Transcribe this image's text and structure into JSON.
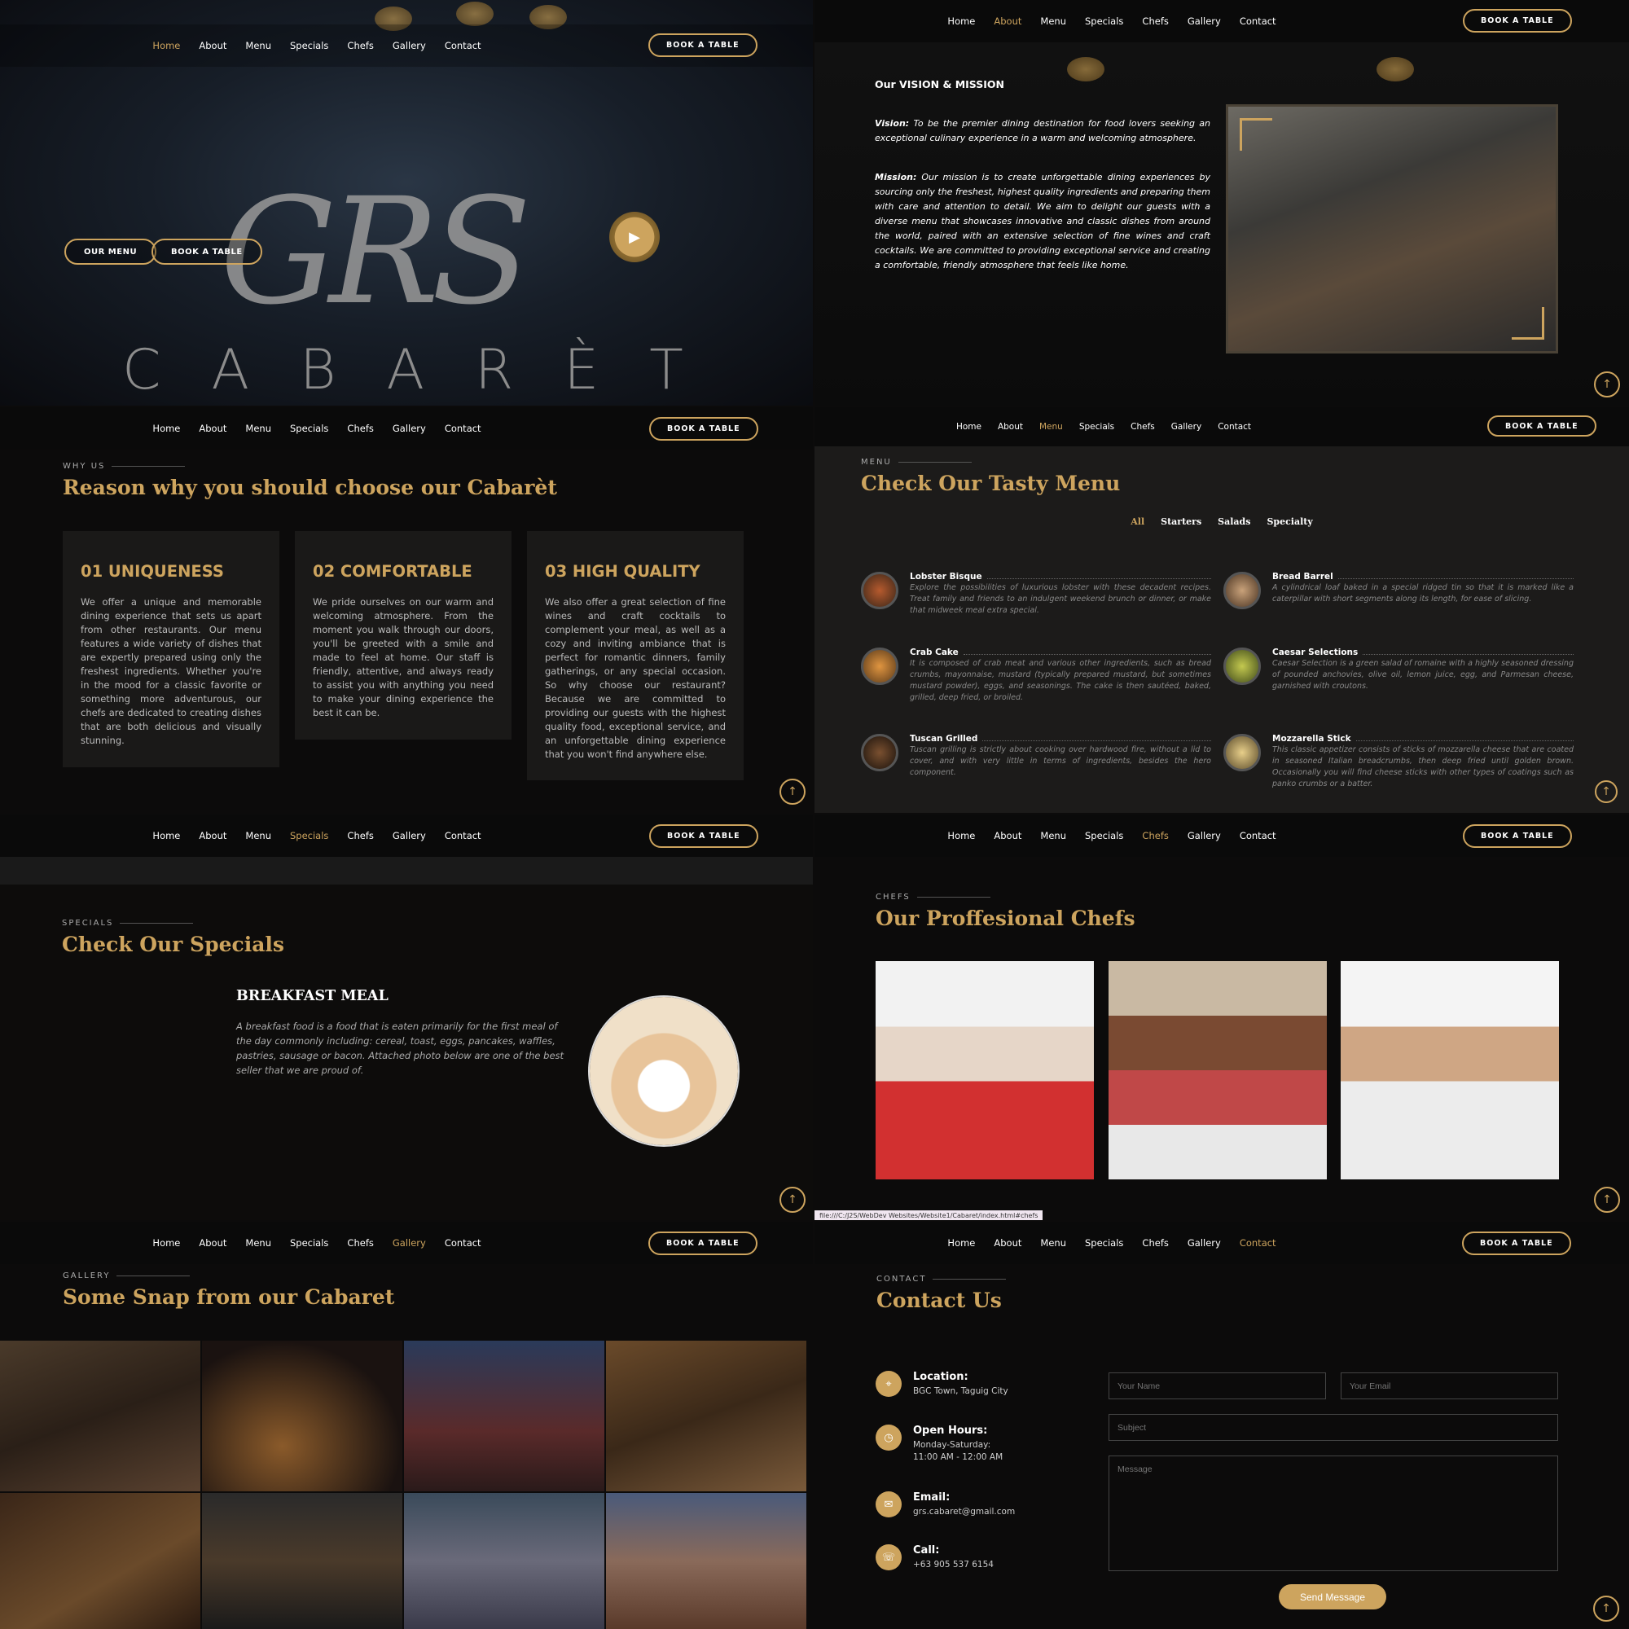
{
  "nav": {
    "links": [
      "Home",
      "About",
      "Menu",
      "Specials",
      "Chefs",
      "Gallery",
      "Contact"
    ],
    "book_label": "BOOK A TABLE"
  },
  "hero": {
    "script_text": "GRS",
    "wordmark": "CABARÈT",
    "our_menu_label": "OUR MENU",
    "book_label": "BOOK A TABLE",
    "active_nav": "Home"
  },
  "about": {
    "heading": "Our VISION & MISSION",
    "vision_label": "Vision:",
    "vision_text": "To be the premier dining destination for food lovers seeking an exceptional culinary experience in a warm and welcoming atmosphere.",
    "mission_label": "Mission:",
    "mission_text": "Our mission is to create unforgettable dining experiences by sourcing only the freshest, highest quality ingredients and preparing them with care and attention to detail. We aim to delight our guests with a diverse menu that showcases innovative and classic dishes from around the world, paired with an extensive selection of fine wines and craft cocktails. We are committed to providing exceptional service and creating a comfortable, friendly atmosphere that feels like home.",
    "active_nav": "About"
  },
  "why": {
    "label": "WHY US",
    "title": "Reason why you should choose our Cabarèt",
    "cards": [
      {
        "title": "01 UNIQUENESS",
        "text": "We offer a unique and memorable dining experience that sets us apart from other restaurants. Our menu features a wide variety of dishes that are expertly prepared using only the freshest ingredients. Whether you're in the mood for a classic favorite or something more adventurous, our chefs are dedicated to creating dishes that are both delicious and visually stunning."
      },
      {
        "title": "02 COMFORTABLE",
        "text": "We pride ourselves on our warm and welcoming atmosphere. From the moment you walk through our doors, you'll be greeted with a smile and made to feel at home. Our staff is friendly, attentive, and always ready to assist you with anything you need to make your dining experience the best it can be."
      },
      {
        "title": "03 HIGH QUALITY",
        "text": "We also offer a great selection of fine wines and craft cocktails to complement your meal, as well as a cozy and inviting ambiance that is perfect for romantic dinners, family gatherings, or any special occasion. So why choose our restaurant? Because we are committed to providing our guests with the highest quality food, exceptional service, and an unforgettable dining experience that you won't find anywhere else."
      }
    ]
  },
  "menu": {
    "label": "MENU",
    "title": "Check Our Tasty Menu",
    "filters": [
      "All",
      "Starters",
      "Salads",
      "Specialty"
    ],
    "active_filter": "All",
    "items": [
      {
        "name": "Lobster Bisque",
        "desc": "Explore the possibilities of luxurious lobster with these decadent recipes. Treat family and friends to an indulgent weekend brunch or dinner, or make that midweek meal extra special."
      },
      {
        "name": "Bread Barrel",
        "desc": "A cylindrical loaf baked in a special ridged tin so that it is marked like a caterpillar with short segments along its length, for ease of slicing."
      },
      {
        "name": "Crab Cake",
        "desc": "It is composed of crab meat and various other ingredients, such as bread crumbs, mayonnaise, mustard (typically prepared mustard, but sometimes mustard powder), eggs, and seasonings. The cake is then sautéed, baked, grilled, deep fried, or broiled."
      },
      {
        "name": "Caesar Selections",
        "desc": "Caesar Selection is a green salad of romaine with a highly seasoned dressing of pounded anchovies, olive oil, lemon juice, egg, and Parmesan cheese, garnished with croutons."
      },
      {
        "name": "Tuscan Grilled",
        "desc": "Tuscan grilling is strictly about cooking over hardwood fire, without a lid to cover, and with very little in terms of ingredients, besides the hero component."
      },
      {
        "name": "Mozzarella Stick",
        "desc": "This classic appetizer consists of sticks of mozzarella cheese that are coated in seasoned Italian breadcrumbs, then deep fried until golden brown. Occasionally you will find cheese sticks with other types of coatings such as panko crumbs or a batter."
      }
    ],
    "active_nav": "Menu"
  },
  "specials": {
    "label": "SPECIALS",
    "title": "Check Our Specials",
    "dish_title": "BREAKFAST MEAL",
    "dish_text": "A breakfast food is a food that is eaten primarily for the first meal of the day commonly including: cereal, toast, eggs, pancakes, waffles, pastries, sausage or bacon. Attached photo below are one of the best seller that we are proud of.",
    "active_nav": "Specials"
  },
  "chefs": {
    "label": "CHEFS",
    "title": "Our Proffesional Chefs",
    "active_nav": "Chefs",
    "status_url": "file:///C:/J2S/WebDev Websites/Website1/Cabaret/index.html#chefs"
  },
  "gallery": {
    "label": "GALLERY",
    "title": "Some Snap from our Cabaret",
    "active_nav": "Gallery"
  },
  "contact": {
    "label": "CONTACT",
    "title": "Contact Us",
    "location_label": "Location:",
    "location_value": "BGC Town, Taguig City",
    "hours_label": "Open Hours:",
    "hours_days": "Monday-Saturday:",
    "hours_time": "11:00 AM - 12:00 AM",
    "email_label": "Email:",
    "email_value": "grs.cabaret@gmail.com",
    "call_label": "Call:",
    "call_value": "+63 905 537 6154",
    "name_placeholder": "Your Name",
    "email_placeholder": "Your Email",
    "subject_placeholder": "Subject",
    "message_placeholder": "Message",
    "send_label": "Send Message",
    "active_nav": "Contact"
  },
  "colors": {
    "accent": "#cda45e",
    "background": "#0c0b0b"
  },
  "icons": {
    "up": "arrow-up-icon",
    "play": "play-icon",
    "location": "map-pin-icon",
    "hours": "clock-icon",
    "email": "envelope-icon",
    "call": "phone-icon"
  }
}
